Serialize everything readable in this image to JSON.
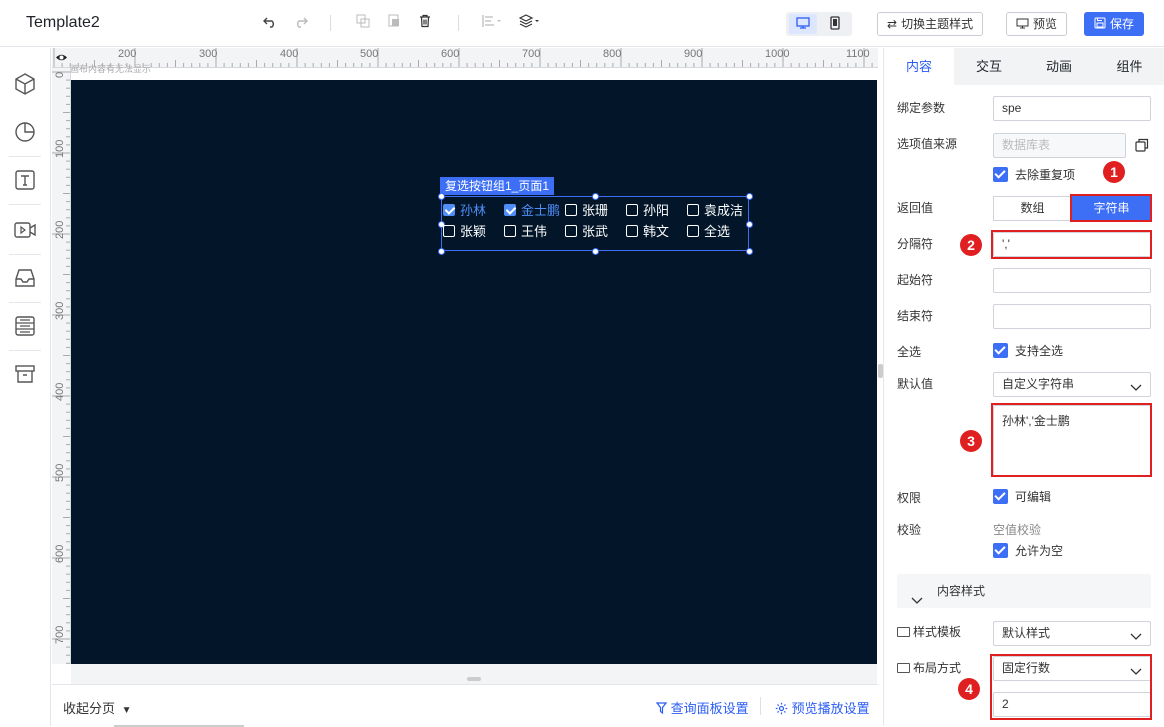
{
  "app": {
    "title": "Template2"
  },
  "toolbar": {
    "switch_theme_label": "切换主题样式",
    "preview_label": "预览",
    "save_label": "保存"
  },
  "ruler": {
    "top_labels": [
      "200",
      "300",
      "400",
      "500",
      "600",
      "700",
      "800",
      "900",
      "1000",
      "1100"
    ],
    "left_labels": [
      "0",
      "100",
      "200",
      "300",
      "400",
      "500",
      "600",
      "700"
    ],
    "hint": "画布内容有无法显示"
  },
  "component": {
    "label": "复选按钮组1_页面1",
    "options": [
      {
        "text": "孙林",
        "checked": true
      },
      {
        "text": "金士鹏",
        "checked": true
      },
      {
        "text": "张珊",
        "checked": false
      },
      {
        "text": "孙阳",
        "checked": false
      },
      {
        "text": "袁成洁",
        "checked": false
      },
      {
        "text": "张颖",
        "checked": false
      },
      {
        "text": "王伟",
        "checked": false
      },
      {
        "text": "张武",
        "checked": false
      },
      {
        "text": "韩文",
        "checked": false
      },
      {
        "text": "全选",
        "checked": false
      }
    ]
  },
  "bottom": {
    "collapse_label": "收起分页",
    "query_panel_label": "查询面板设置",
    "preview_play_label": "预览播放设置"
  },
  "panel": {
    "tabs": [
      "内容",
      "交互",
      "动画",
      "组件"
    ],
    "bind_param": {
      "label": "绑定参数",
      "value": "spe"
    },
    "option_source": {
      "label": "选项值来源",
      "placeholder": "数据库表"
    },
    "dedupe_label": "去除重复项",
    "return_value": {
      "label": "返回值",
      "options": [
        "数组",
        "字符串"
      ],
      "selected": "字符串"
    },
    "separator": {
      "label": "分隔符",
      "value": "','"
    },
    "start_char": {
      "label": "起始符",
      "value": ""
    },
    "end_char": {
      "label": "结束符",
      "value": ""
    },
    "select_all": {
      "label": "全选",
      "check_label": "支持全选"
    },
    "default_value": {
      "label": "默认值",
      "select": "自定义字符串",
      "text": "孙林','金士鹏"
    },
    "permission": {
      "label": "权限",
      "check_label": "可编辑"
    },
    "validation": {
      "label": "校验",
      "sub": "空值校验",
      "check_label": "允许为空"
    },
    "content_style_header": "内容样式",
    "style_template": {
      "label": "样式模板",
      "value": "默认样式"
    },
    "layout_mode": {
      "label": "布局方式",
      "value": "固定行数",
      "rows": "2"
    }
  },
  "annotations": [
    "1",
    "2",
    "3",
    "4"
  ],
  "colors": {
    "accent": "#3c6ef6",
    "canvas_bg": "#021529",
    "annotation_red": "#e02020"
  }
}
